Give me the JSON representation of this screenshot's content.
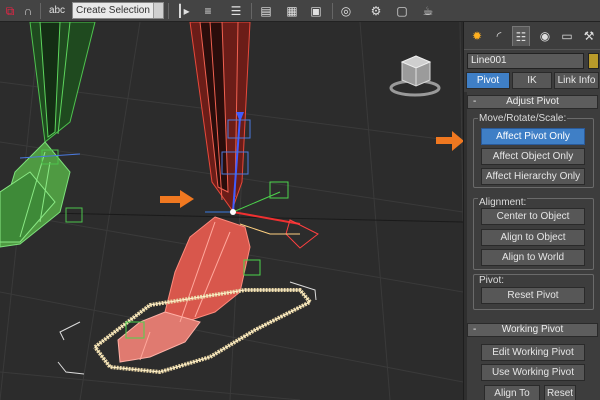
{
  "toolbar": {
    "selection_set_placeholder": "Create Selection Se",
    "icons": [
      "unlink-icon",
      "bind-to-space-warp-icon",
      "selection-filter-icon",
      "named-selection-sets-icon",
      "mirror-icon",
      "align-icon",
      "layer-manager-icon",
      "graphite-modeling-icon",
      "curve-editor-icon",
      "schematic-view-icon",
      "material-editor-icon",
      "render-setup-icon",
      "rendered-frame-window-icon",
      "render-production-icon"
    ]
  },
  "command_panel": {
    "tab_icons": [
      "create-icon",
      "modify-icon",
      "hierarchy-icon",
      "motion-icon",
      "display-icon",
      "utilities-icon"
    ],
    "active_tab": "hierarchy",
    "object_name": "Line001",
    "object_color": "#b89a2a",
    "hierarchy_tabs": [
      {
        "label": "Pivot",
        "active": true
      },
      {
        "label": "IK",
        "active": false
      },
      {
        "label": "Link Info",
        "active": false
      }
    ],
    "adjust_pivot": {
      "title": "Adjust Pivot",
      "collapse": "-",
      "move_rotate_scale": {
        "title": "Move/Rotate/Scale:",
        "buttons": [
          {
            "label": "Affect Pivot Only",
            "active": true
          },
          {
            "label": "Affect Object Only",
            "active": false
          },
          {
            "label": "Affect Hierarchy Only",
            "active": false
          }
        ]
      },
      "alignment": {
        "title": "Alignment:",
        "buttons": [
          {
            "label": "Center to Object"
          },
          {
            "label": "Align to Object"
          },
          {
            "label": "Align to World"
          }
        ]
      },
      "pivot": {
        "title": "Pivot:",
        "reset_label": "Reset Pivot"
      }
    },
    "working_pivot": {
      "title": "Working Pivot",
      "collapse": "-",
      "edit_label": "Edit Working Pivot",
      "use_label": "Use Working Pivot",
      "align_to_view_label": "Align To View",
      "reset_label": "Reset"
    }
  },
  "colors": {
    "accent_blue": "#3f7fc6",
    "arrow_orange": "#f07820",
    "red_leg": "#d8473c",
    "green_leg": "#4aa84a",
    "spline_tan": "#e8d6a8"
  }
}
